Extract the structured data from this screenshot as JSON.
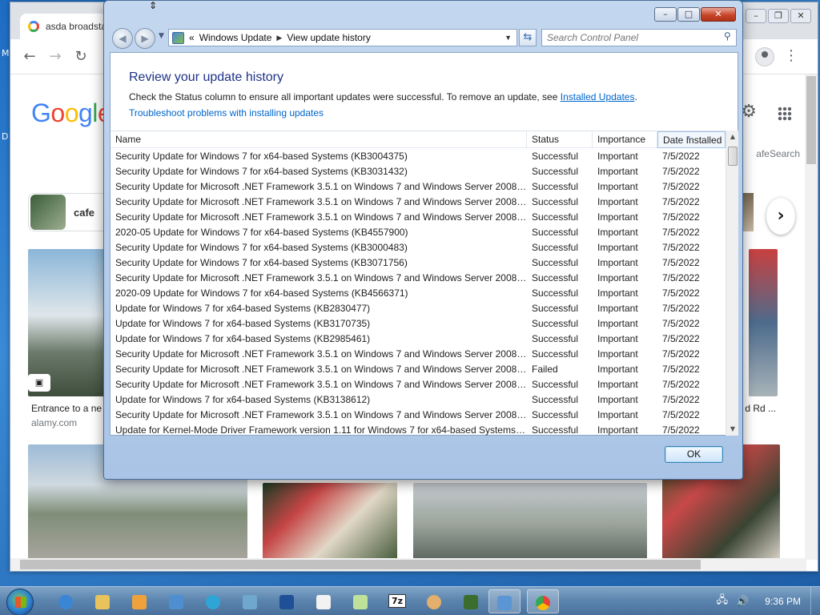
{
  "browser": {
    "tab_title": "asda broadsta",
    "search_chip_label": "cafe",
    "safesearch_label": "afeSearch",
    "captions": {
      "left_title": "Entrance to a ne",
      "left_source": "alamy.com",
      "right_title": "d Rd ..."
    },
    "desktop_left_labels": [
      "M",
      "D"
    ]
  },
  "dialog": {
    "address": {
      "prefix": "«",
      "crumb_1": "Windows Update",
      "crumb_2": "View update history"
    },
    "search_placeholder": "Search Control Panel",
    "heading": "Review your update history",
    "description": "Check the Status column to ensure all important updates were successful. To remove an update, see",
    "installed_updates_link": "Installed Updates",
    "description_end": ".",
    "troubleshoot_link": "Troubleshoot problems with installing updates",
    "columns": {
      "name": "Name",
      "status": "Status",
      "importance": "Importance",
      "date": "Date Installed"
    },
    "updates": [
      {
        "name": "Security Update for Windows 7 for x64-based Systems (KB3004375)",
        "status": "Successful",
        "importance": "Important",
        "date": "7/5/2022"
      },
      {
        "name": "Security Update for Windows 7 for x64-based Systems (KB3031432)",
        "status": "Successful",
        "importance": "Important",
        "date": "7/5/2022"
      },
      {
        "name": "Security Update for Microsoft .NET Framework 3.5.1 on Windows 7 and Windows Server 2008 R2...",
        "status": "Successful",
        "importance": "Important",
        "date": "7/5/2022"
      },
      {
        "name": "Security Update for Microsoft .NET Framework 3.5.1 on Windows 7 and Windows Server 2008 R2...",
        "status": "Successful",
        "importance": "Important",
        "date": "7/5/2022"
      },
      {
        "name": "Security Update for Microsoft .NET Framework 3.5.1 on Windows 7 and Windows Server 2008 R2...",
        "status": "Successful",
        "importance": "Important",
        "date": "7/5/2022"
      },
      {
        "name": "2020-05 Update for Windows 7 for x64-based Systems (KB4557900)",
        "status": "Successful",
        "importance": "Important",
        "date": "7/5/2022"
      },
      {
        "name": "Security Update for Windows 7 for x64-based Systems (KB3000483)",
        "status": "Successful",
        "importance": "Important",
        "date": "7/5/2022"
      },
      {
        "name": "Security Update for Windows 7 for x64-based Systems (KB3071756)",
        "status": "Successful",
        "importance": "Important",
        "date": "7/5/2022"
      },
      {
        "name": "Security Update for Microsoft .NET Framework 3.5.1 on Windows 7 and Windows Server 2008 R2...",
        "status": "Successful",
        "importance": "Important",
        "date": "7/5/2022"
      },
      {
        "name": "2020-09 Update for Windows 7 for x64-based Systems (KB4566371)",
        "status": "Successful",
        "importance": "Important",
        "date": "7/5/2022"
      },
      {
        "name": "Update for Windows 7 for x64-based Systems (KB2830477)",
        "status": "Successful",
        "importance": "Important",
        "date": "7/5/2022"
      },
      {
        "name": "Update for Windows 7 for x64-based Systems (KB3170735)",
        "status": "Successful",
        "importance": "Important",
        "date": "7/5/2022"
      },
      {
        "name": "Update for Windows 7 for x64-based Systems (KB2985461)",
        "status": "Successful",
        "importance": "Important",
        "date": "7/5/2022"
      },
      {
        "name": "Security Update for Microsoft .NET Framework 3.5.1 on Windows 7 and Windows Server 2008 R2...",
        "status": "Successful",
        "importance": "Important",
        "date": "7/5/2022"
      },
      {
        "name": "Security Update for Microsoft .NET Framework 3.5.1 on Windows 7 and Windows Server 2008 R2...",
        "status": "Failed",
        "importance": "Important",
        "date": "7/5/2022"
      },
      {
        "name": "Security Update for Microsoft .NET Framework 3.5.1 on Windows 7 and Windows Server 2008 R2...",
        "status": "Successful",
        "importance": "Important",
        "date": "7/5/2022"
      },
      {
        "name": "Update for Windows 7 for x64-based Systems (KB3138612)",
        "status": "Successful",
        "importance": "Important",
        "date": "7/5/2022"
      },
      {
        "name": "Security Update for Microsoft .NET Framework 3.5.1 on Windows 7 and Windows Server 2008 R2...",
        "status": "Successful",
        "importance": "Important",
        "date": "7/5/2022"
      },
      {
        "name": "Update for Kernel-Mode Driver Framework version 1.11 for Windows 7 for x64-based Systems (K...",
        "status": "Successful",
        "importance": "Important",
        "date": "7/5/2022"
      }
    ],
    "ok_label": "OK"
  },
  "taskbar": {
    "clock": "9:36 PM",
    "items": [
      "internet-explorer",
      "file-explorer",
      "media-player",
      "control-panel",
      "edge",
      "network-settings",
      "powershell",
      "document",
      "notepad",
      "7zip",
      "paint",
      "terminal",
      "control-panel-active",
      "chrome"
    ],
    "seven_zip_label": "7z"
  },
  "colors": {
    "link": "#0066cc",
    "heading": "#1e3287",
    "titlebar": "#b9d0ec",
    "close_button": "#c8452a"
  }
}
